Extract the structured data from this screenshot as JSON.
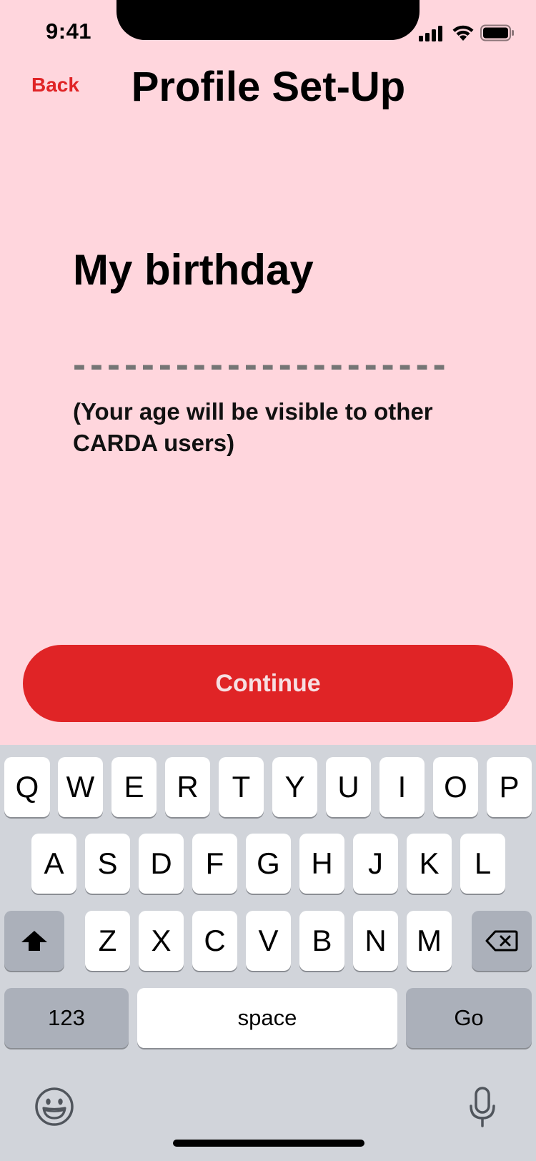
{
  "status_bar": {
    "time": "9:41"
  },
  "header": {
    "back_label": "Back",
    "title": "Profile Set-Up"
  },
  "form": {
    "question": "My birthday",
    "date_placeholder": "----------------------",
    "note": "(Your age will be visible to other CARDA users)"
  },
  "continue_label": "Continue",
  "colors": {
    "background": "#ffd6dd",
    "accent": "#e02426",
    "keyboard": "#d1d4da"
  },
  "keyboard": {
    "row1": [
      "Q",
      "W",
      "E",
      "R",
      "T",
      "Y",
      "U",
      "I",
      "O",
      "P"
    ],
    "row2": [
      "A",
      "S",
      "D",
      "F",
      "G",
      "H",
      "J",
      "K",
      "L"
    ],
    "row3": [
      "Z",
      "X",
      "C",
      "V",
      "B",
      "N",
      "M"
    ],
    "numbers_label": "123",
    "space_label": "space",
    "go_label": "Go",
    "icons": [
      "shift-icon",
      "backspace-icon",
      "emoji-icon",
      "microphone-icon"
    ]
  }
}
